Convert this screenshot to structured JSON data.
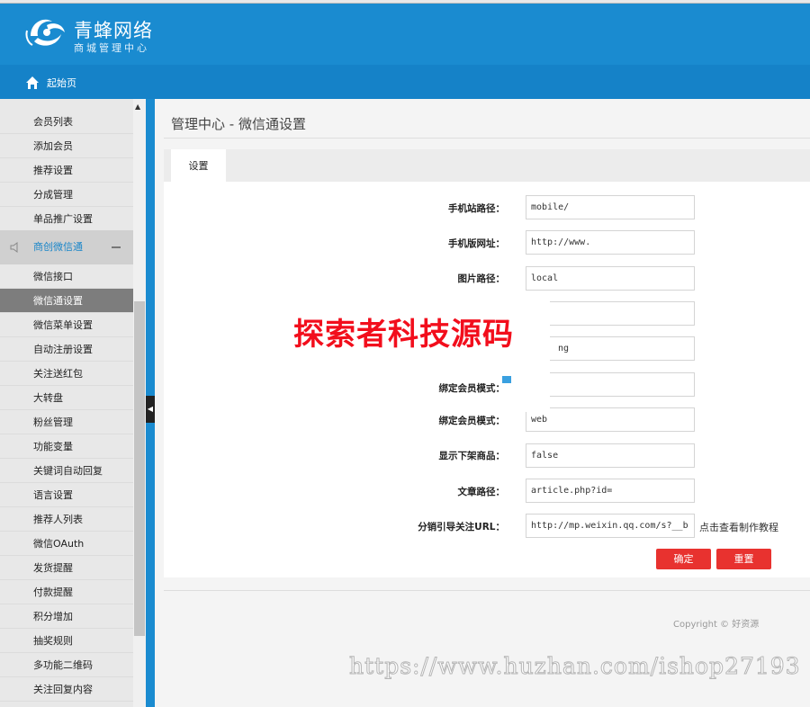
{
  "header": {
    "brand": "青蜂网络",
    "brand_sub": "商城管理中心",
    "home_label": "起始页"
  },
  "sidebar": {
    "items_top": [
      "会员列表",
      "添加会员",
      "推荐设置",
      "分成管理",
      "单品推广设置"
    ],
    "group_label": "商创微信通",
    "items": [
      "微信接口",
      "微信通设置",
      "微信菜单设置",
      "自动注册设置",
      "关注送红包",
      "大转盘",
      "粉丝管理",
      "功能变量",
      "关键词自动回复",
      "语言设置",
      "推荐人列表",
      "微信OAuth",
      "发货提醒",
      "付款提醒",
      "积分增加",
      "抽奖规则",
      "多功能二维码",
      "关注回复内容"
    ],
    "active_item": "微信通设置"
  },
  "main": {
    "page_title": "管理中心 - 微信通设置",
    "tab_label": "设置",
    "fields": [
      {
        "label": "手机站路径：",
        "value": "mobile/"
      },
      {
        "label": "手机版网址：",
        "value": "http://www."
      },
      {
        "label": "图片路径：",
        "value": "local"
      },
      {
        "label": "",
        "value": ""
      },
      {
        "label": "",
        "value": "ng"
      },
      {
        "label": "绑定会员模式：",
        "value": ""
      },
      {
        "label": "绑定会员模式：",
        "value": "web"
      },
      {
        "label": "显示下架商品：",
        "value": "false"
      },
      {
        "label": "文章路径：",
        "value": "article.php?id="
      },
      {
        "label": "分销引导关注URL：",
        "value": "http://mp.weixin.qq.com/s?__b"
      }
    ],
    "help_link": "点击查看制作教程",
    "confirm_label": "确定",
    "reset_label": "重置",
    "copyright": "Copyright © 好资源"
  },
  "watermarks": {
    "banner": "探索者科技源码",
    "url": "https://www.huzhan.com/ishop27193"
  },
  "colors": {
    "header_blue": "#1a8bd0",
    "nav_blue": "#1582c8",
    "button_red": "#e8322f",
    "watermark_red": "#f20e1c"
  }
}
